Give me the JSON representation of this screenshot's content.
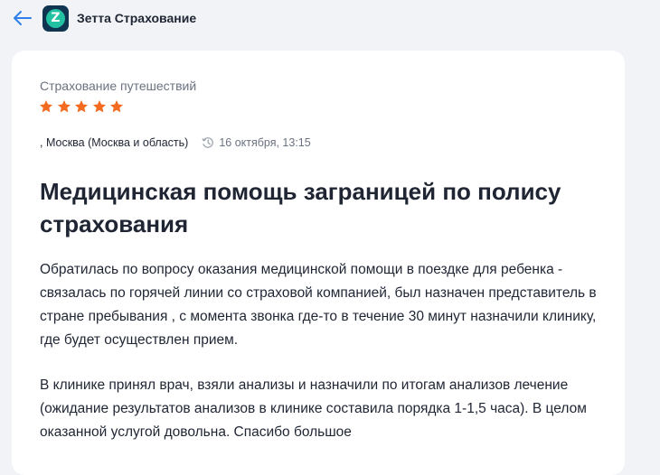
{
  "header": {
    "back_icon": "arrow-left-icon",
    "company_logo_letter": "Z",
    "company_name": "Зетта Страхование"
  },
  "review": {
    "category": "Страхование путешествий",
    "rating": 5,
    "rating_max": 5,
    "location": ", Москва (Москва и область)",
    "date": "16 октября, 13:15",
    "title": "Медицинская помощь заграницей по полису страхования",
    "paragraphs": [
      "Обратилась по вопросу оказания медицинской помощи в поездке для ребенка - связалась по горячей линии со страховой компанией, был назначен представитель в стране пребывания , с момента звонка где-то в течение 30 минут назначили клинику, где будет осуществлен прием.",
      "В клинике принял врач, взяли анализы и назначили по итогам анализов лечение (ожидание результатов анализов в клинике составила порядка 1-1,5 часа). В целом оказанной услугой довольна. Спасибо большое"
    ]
  },
  "colors": {
    "accent": "#2f80ed",
    "star": "#f26b21",
    "logo_bg": "#0f3550",
    "logo_circle": "#22c1a2",
    "page_bg": "#f1f3f7",
    "card_bg": "#ffffff",
    "muted_text": "#6b7280"
  }
}
